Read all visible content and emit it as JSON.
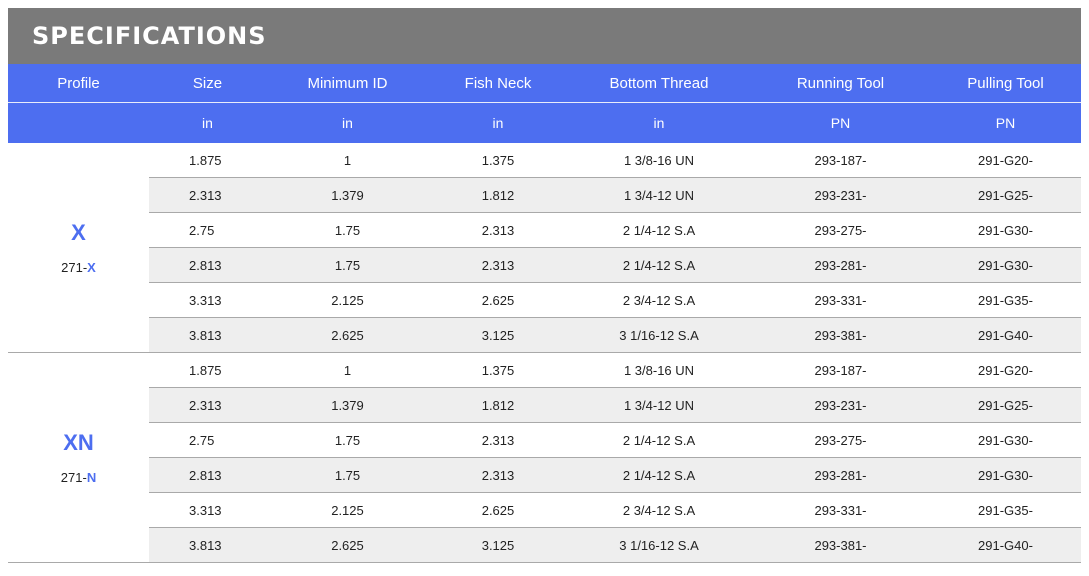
{
  "title": "SPECIFICATIONS",
  "headers": [
    "Profile",
    "Size",
    "Minimum ID",
    "Fish Neck",
    "Bottom Thread",
    "Running Tool",
    "Pulling Tool"
  ],
  "units": [
    "",
    "in",
    "in",
    "in",
    "in",
    "PN",
    "PN"
  ],
  "groups": [
    {
      "profile": "X",
      "part_prefix": "271-",
      "part_suffix": "X",
      "rows": [
        [
          "1.875",
          "1",
          "1.375",
          "1 3/8-16 UN",
          "293-187-",
          "291-G20-"
        ],
        [
          "2.313",
          "1.379",
          "1.812",
          "1 3/4-12 UN",
          "293-231-",
          "291-G25-"
        ],
        [
          "2.75",
          "1.75",
          "2.313",
          "2 1/4-12 S.A",
          "293-275-",
          "291-G30-"
        ],
        [
          "2.813",
          "1.75",
          "2.313",
          "2 1/4-12 S.A",
          "293-281-",
          "291-G30-"
        ],
        [
          "3.313",
          "2.125",
          "2.625",
          "2 3/4-12 S.A",
          "293-331-",
          "291-G35-"
        ],
        [
          "3.813",
          "2.625",
          "3.125",
          "3 1/16-12 S.A",
          "293-381-",
          "291-G40-"
        ]
      ]
    },
    {
      "profile": "XN",
      "part_prefix": "271-",
      "part_suffix": "N",
      "rows": [
        [
          "1.875",
          "1",
          "1.375",
          "1 3/8-16 UN",
          "293-187-",
          "291-G20-"
        ],
        [
          "2.313",
          "1.379",
          "1.812",
          "1 3/4-12 UN",
          "293-231-",
          "291-G25-"
        ],
        [
          "2.75",
          "1.75",
          "2.313",
          "2 1/4-12 S.A",
          "293-275-",
          "291-G30-"
        ],
        [
          "2.813",
          "1.75",
          "2.313",
          "2 1/4-12 S.A",
          "293-281-",
          "291-G30-"
        ],
        [
          "3.313",
          "2.125",
          "2.625",
          "2 3/4-12 S.A",
          "293-331-",
          "291-G35-"
        ],
        [
          "3.813",
          "2.625",
          "3.125",
          "3 1/16-12 S.A",
          "293-381-",
          "291-G40-"
        ]
      ]
    }
  ],
  "colors": {
    "accent": "#4d6ef0",
    "title_bg": "#7a7a7a",
    "alt_row": "#eeeeee"
  }
}
